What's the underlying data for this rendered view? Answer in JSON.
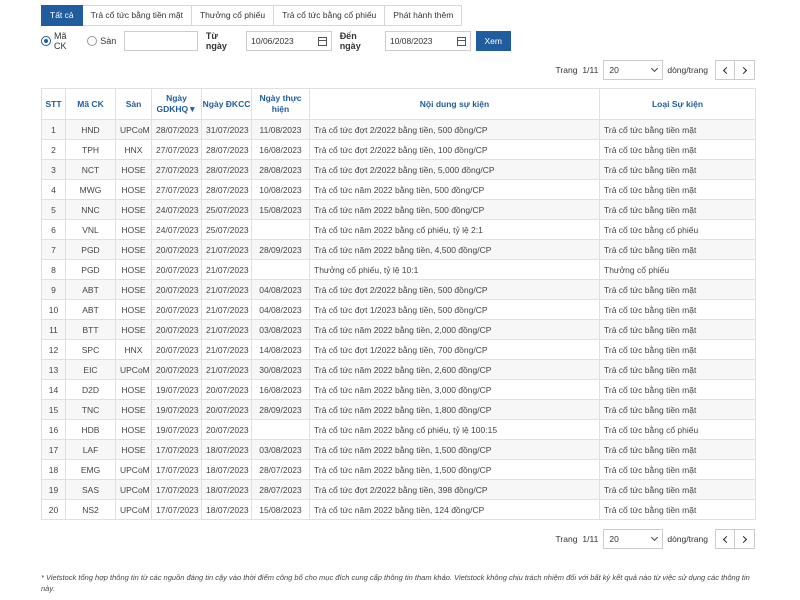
{
  "tabs": [
    {
      "label": "Tất cả",
      "active": true
    },
    {
      "label": "Trả cổ tức bằng tiền mặt",
      "active": false
    },
    {
      "label": "Thưởng cổ phiếu",
      "active": false
    },
    {
      "label": "Trả cổ tức bằng cổ phiếu",
      "active": false
    },
    {
      "label": "Phát hành thêm",
      "active": false
    }
  ],
  "filter": {
    "radio_code": "Mã CK",
    "radio_exchange": "Sàn",
    "code_value": "",
    "from_label": "Từ ngày",
    "from_value": "10/06/2023",
    "to_label": "Đến ngày",
    "to_value": "10/08/2023",
    "submit_label": "Xem"
  },
  "pager": {
    "page_label": "Trang",
    "page_value": "1/11",
    "rows_value": "20",
    "rows_suffix": "dòng/trang"
  },
  "table": {
    "headers": {
      "stt": "STT",
      "code": "Mã CK",
      "exchange": "Sàn",
      "gdkhq": "Ngày GDKHQ▼",
      "dkcc": "Ngày ĐKCC",
      "exec": "Ngày thực hiện",
      "content": "Nội dung sự kiện",
      "type": "Loại Sự kiện"
    },
    "rows": [
      [
        "1",
        "HND",
        "UPCoM",
        "28/07/2023",
        "31/07/2023",
        "11/08/2023",
        "Trả cổ tức đợt 2/2022 bằng tiền, 500 đồng/CP",
        "Trả cổ tức bằng tiền mặt"
      ],
      [
        "2",
        "TPH",
        "HNX",
        "27/07/2023",
        "28/07/2023",
        "16/08/2023",
        "Trả cổ tức đợt 2/2022 bằng tiền, 100 đồng/CP",
        "Trả cổ tức bằng tiền mặt"
      ],
      [
        "3",
        "NCT",
        "HOSE",
        "27/07/2023",
        "28/07/2023",
        "28/08/2023",
        "Trả cổ tức đợt 2/2022 bằng tiền, 5,000 đồng/CP",
        "Trả cổ tức bằng tiền mặt"
      ],
      [
        "4",
        "MWG",
        "HOSE",
        "27/07/2023",
        "28/07/2023",
        "10/08/2023",
        "Trả cổ tức năm 2022 bằng tiền, 500 đồng/CP",
        "Trả cổ tức bằng tiền mặt"
      ],
      [
        "5",
        "NNC",
        "HOSE",
        "24/07/2023",
        "25/07/2023",
        "15/08/2023",
        "Trả cổ tức năm 2022 bằng tiền, 500 đồng/CP",
        "Trả cổ tức bằng tiền mặt"
      ],
      [
        "6",
        "VNL",
        "HOSE",
        "24/07/2023",
        "25/07/2023",
        "",
        "Trả cổ tức năm 2022 bằng cổ phiếu, tỷ lệ 2:1",
        "Trả cổ tức bằng cổ phiếu"
      ],
      [
        "7",
        "PGD",
        "HOSE",
        "20/07/2023",
        "21/07/2023",
        "28/09/2023",
        "Trả cổ tức năm 2022 bằng tiền, 4,500 đồng/CP",
        "Trả cổ tức bằng tiền mặt"
      ],
      [
        "8",
        "PGD",
        "HOSE",
        "20/07/2023",
        "21/07/2023",
        "",
        "Thưởng cổ phiếu, tỷ lệ 10:1",
        "Thưởng cổ phiếu"
      ],
      [
        "9",
        "ABT",
        "HOSE",
        "20/07/2023",
        "21/07/2023",
        "04/08/2023",
        "Trả cổ tức đợt 2/2022 bằng tiền, 500 đồng/CP",
        "Trả cổ tức bằng tiền mặt"
      ],
      [
        "10",
        "ABT",
        "HOSE",
        "20/07/2023",
        "21/07/2023",
        "04/08/2023",
        "Trả cổ tức đợt 1/2023 bằng tiền, 500 đồng/CP",
        "Trả cổ tức bằng tiền mặt"
      ],
      [
        "11",
        "BTT",
        "HOSE",
        "20/07/2023",
        "21/07/2023",
        "03/08/2023",
        "Trả cổ tức năm 2022 bằng tiền, 2,000 đồng/CP",
        "Trả cổ tức bằng tiền mặt"
      ],
      [
        "12",
        "SPC",
        "HNX",
        "20/07/2023",
        "21/07/2023",
        "14/08/2023",
        "Trả cổ tức đợt 1/2022 bằng tiền, 700 đồng/CP",
        "Trả cổ tức bằng tiền mặt"
      ],
      [
        "13",
        "EIC",
        "UPCoM",
        "20/07/2023",
        "21/07/2023",
        "30/08/2023",
        "Trả cổ tức năm 2022 bằng tiền, 2,600 đồng/CP",
        "Trả cổ tức bằng tiền mặt"
      ],
      [
        "14",
        "D2D",
        "HOSE",
        "19/07/2023",
        "20/07/2023",
        "16/08/2023",
        "Trả cổ tức năm 2022 bằng tiền, 3,000 đồng/CP",
        "Trả cổ tức bằng tiền mặt"
      ],
      [
        "15",
        "TNC",
        "HOSE",
        "19/07/2023",
        "20/07/2023",
        "28/09/2023",
        "Trả cổ tức năm 2022 bằng tiền, 1,800 đồng/CP",
        "Trả cổ tức bằng tiền mặt"
      ],
      [
        "16",
        "HDB",
        "HOSE",
        "19/07/2023",
        "20/07/2023",
        "",
        "Trả cổ tức năm 2022 bằng cổ phiếu, tỷ lệ 100:15",
        "Trả cổ tức bằng cổ phiếu"
      ],
      [
        "17",
        "LAF",
        "HOSE",
        "17/07/2023",
        "18/07/2023",
        "03/08/2023",
        "Trả cổ tức năm 2022 bằng tiền, 1,500 đồng/CP",
        "Trả cổ tức bằng tiền mặt"
      ],
      [
        "18",
        "EMG",
        "UPCoM",
        "17/07/2023",
        "18/07/2023",
        "28/07/2023",
        "Trả cổ tức năm 2022 bằng tiền, 1,500 đồng/CP",
        "Trả cổ tức bằng tiền mặt"
      ],
      [
        "19",
        "SAS",
        "UPCoM",
        "17/07/2023",
        "18/07/2023",
        "28/07/2023",
        "Trả cổ tức đợt 2/2022 bằng tiền, 398 đồng/CP",
        "Trả cổ tức bằng tiền mặt"
      ],
      [
        "20",
        "NS2",
        "UPCoM",
        "17/07/2023",
        "18/07/2023",
        "15/08/2023",
        "Trả cổ tức năm 2022 bằng tiền, 124 đồng/CP",
        "Trả cổ tức bằng tiền mặt"
      ]
    ]
  },
  "disclaimer": "* Vietstock tổng hợp thông tin từ các nguồn đáng tin cậy vào thời điểm công bố cho mục đích cung cấp thông tin tham khảo. Vietstock không chịu trách nhiệm đối với bất kỳ kết quả nào từ việc sử dụng các thông tin này.",
  "colors": {
    "accent": "#1f5d9e",
    "row_alt": "#f7f7f7",
    "border": "#e0e0e0"
  }
}
